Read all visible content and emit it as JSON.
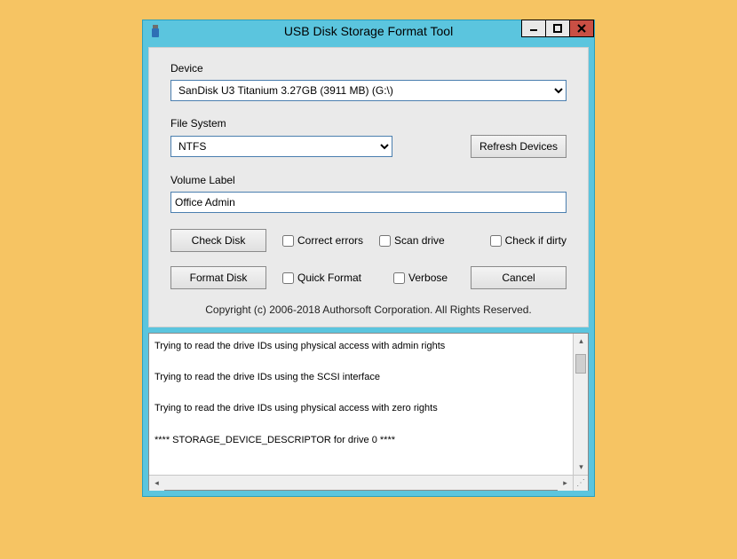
{
  "window": {
    "title": "USB Disk Storage Format Tool"
  },
  "labels": {
    "device": "Device",
    "filesystem": "File System",
    "volume": "Volume Label"
  },
  "values": {
    "device": "SanDisk U3 Titanium 3.27GB (3911 MB)  (G:\\)",
    "filesystem": "NTFS",
    "volume": "Office Admin"
  },
  "buttons": {
    "refresh": "Refresh Devices",
    "check_disk": "Check Disk",
    "format_disk": "Format Disk",
    "cancel": "Cancel"
  },
  "checkboxes": {
    "correct_errors": "Correct errors",
    "scan_drive": "Scan drive",
    "check_dirty": "Check if dirty",
    "quick_format": "Quick Format",
    "verbose": "Verbose"
  },
  "copyright": "Copyright (c) 2006-2018 Authorsoft Corporation. All Rights Reserved.",
  "log": {
    "lines": [
      "Trying to read the drive IDs using physical access with admin rights",
      "Trying to read the drive IDs using the SCSI interface",
      "Trying to read the drive IDs using physical access with zero rights",
      "**** STORAGE_DEVICE_DESCRIPTOR for drive 0 ****"
    ]
  }
}
